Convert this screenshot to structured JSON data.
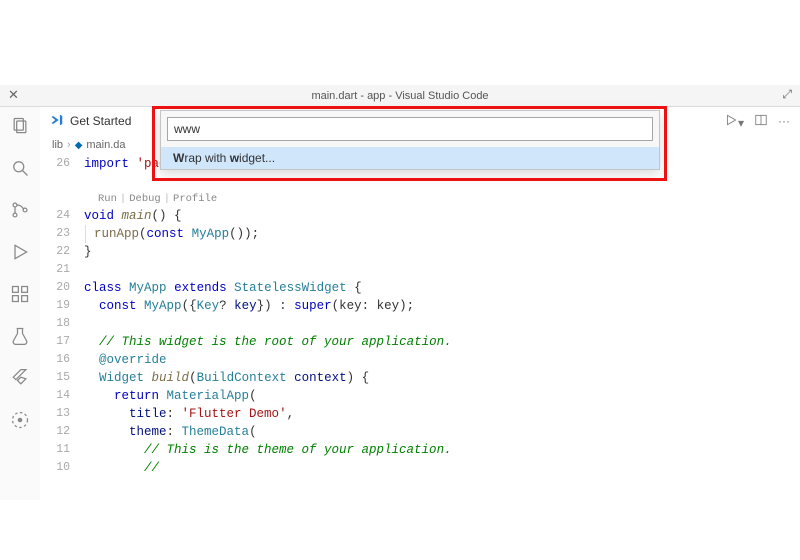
{
  "window": {
    "title": "main.dart - app - Visual Studio Code"
  },
  "tabs": {
    "get_started": "Get Started"
  },
  "palette": {
    "input_value": "www",
    "option_pre": "W",
    "option_mid": "rap with ",
    "option_mid2": "w",
    "option_rest": "idget..."
  },
  "breadcrumb": {
    "folder": "lib",
    "file": "main.da"
  },
  "codelens": {
    "run": "Run",
    "debug": "Debug",
    "profile": "Profile"
  },
  "gutter": [
    "26",
    "",
    "24",
    "23",
    "22",
    "21",
    "20",
    "19",
    "18",
    "17",
    "16",
    "15",
    "14",
    "13",
    "12",
    "11",
    "10"
  ],
  "code": {
    "l26": {
      "kw": "import",
      "sp": " ",
      "str": "'package:flutter/material.dart'",
      "semi": ";"
    },
    "l24": {
      "kw": "void",
      "sp": " ",
      "fn": "main",
      "rest": "() {"
    },
    "l23": {
      "indent": "  ",
      "call": "runApp",
      "open": "(",
      "kw": "const",
      "sp": " ",
      "cls": "MyApp",
      "rest": "());"
    },
    "l22": {
      "text": "}"
    },
    "l20": {
      "kw1": "class",
      "sp1": " ",
      "cls1": "MyApp",
      "sp2": " ",
      "kw2": "extends",
      "sp3": " ",
      "cls2": "StatelessWidget",
      "rest": " {"
    },
    "l19": {
      "indent": "  ",
      "kw": "const",
      "sp": " ",
      "cls": "MyApp",
      "open": "({",
      "cls2": "Key",
      "q": "?",
      "sp2": " ",
      "ident": "key",
      "rest": "}) : ",
      "kw2": "super",
      "rest2": "(key: key);"
    },
    "l17": {
      "indent": "  ",
      "cmnt": "// This widget is the root of your application."
    },
    "l16": {
      "indent": "  ",
      "at": "@override"
    },
    "l15": {
      "indent": "  ",
      "cls": "Widget",
      "sp": " ",
      "fn": "build",
      "open": "(",
      "cls2": "BuildContext",
      "sp2": " ",
      "ident": "context",
      "rest": ") {"
    },
    "l14": {
      "indent": "    ",
      "kw": "return",
      "sp": " ",
      "cls": "MaterialApp",
      "rest": "("
    },
    "l13": {
      "indent": "      ",
      "ident": "title",
      "colon": ": ",
      "str": "'Flutter Demo'",
      "comma": ","
    },
    "l12": {
      "indent": "      ",
      "ident": "theme",
      "colon": ": ",
      "cls": "ThemeData",
      "rest": "("
    },
    "l11": {
      "indent": "        ",
      "cmnt": "// This is the theme of your application."
    },
    "l10": {
      "indent": "        ",
      "cmnt": "//"
    }
  }
}
